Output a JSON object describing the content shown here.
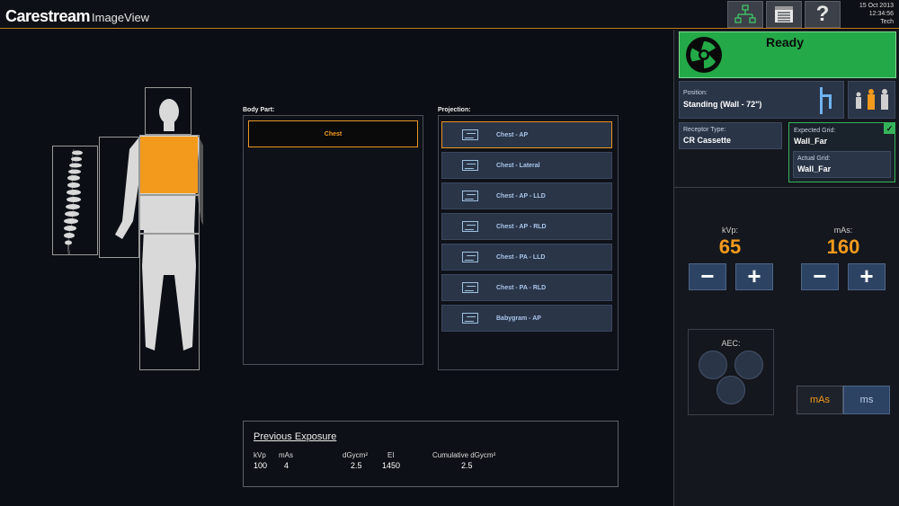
{
  "header": {
    "brand": "Carestream",
    "product": "ImageView",
    "date": "15 Oct 2013",
    "time": "12:34:56",
    "user": "Tech",
    "icons": [
      "network-icon",
      "worklist-icon",
      "help-icon"
    ],
    "help_label": "?"
  },
  "body_part": {
    "label": "Body Part:",
    "selected": "Chest"
  },
  "projection": {
    "label": "Projection:",
    "items": [
      {
        "label": "Chest - AP",
        "selected": true
      },
      {
        "label": "Chest - Lateral"
      },
      {
        "label": "Chest - AP - LLD"
      },
      {
        "label": "Chest - AP - RLD"
      },
      {
        "label": "Chest - PA - LLD"
      },
      {
        "label": "Chest - PA - RLD"
      },
      {
        "label": "Babygram - AP"
      }
    ]
  },
  "previous_exposure": {
    "title": "Previous Exposure",
    "headers": {
      "kvp": "kVp",
      "mas": "mAs",
      "dgy": "dGycm²",
      "ei": "EI",
      "cum": "Cumulative dGycm²"
    },
    "values": {
      "kvp": "100",
      "mas": "4",
      "dgy": "2.5",
      "ei": "1450",
      "cum": "2.5"
    }
  },
  "status": {
    "label": "Ready",
    "color": "#23a948"
  },
  "position": {
    "label": "Position:",
    "value": "Standing (Wall - 72\")"
  },
  "receptor": {
    "label": "Receptor Type:",
    "value": "CR Cassette"
  },
  "grid": {
    "expected_label": "Expected Grid:",
    "expected_value": "Wall_Far",
    "actual_label": "Actual Grid:",
    "actual_value": "Wall_Far",
    "check": "✓"
  },
  "technique": {
    "kvp_label": "kVp:",
    "kvp_value": "65",
    "mas_label": "mAs:",
    "mas_value": "160",
    "minus": "−",
    "plus": "+"
  },
  "aec": {
    "label": "AEC:"
  },
  "mode_toggle": {
    "options": [
      "mAs",
      "ms"
    ],
    "selected": "mAs"
  },
  "colors": {
    "accent": "#f39a1d",
    "ready": "#23a948",
    "button_blue": "#2d4364"
  }
}
